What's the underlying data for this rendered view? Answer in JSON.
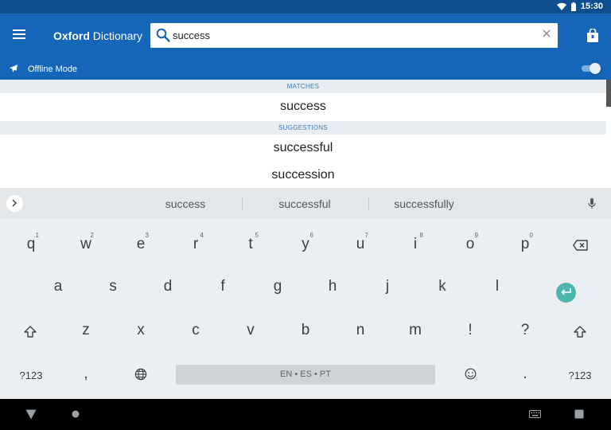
{
  "status_bar": {
    "time": "15:30"
  },
  "app_bar": {
    "title_bold": "Oxford",
    "title_rest": " Dictionary",
    "search": {
      "value": "success",
      "placeholder": ""
    }
  },
  "offline": {
    "label": "Offline Mode",
    "enabled": true
  },
  "results": {
    "matches_header": "MATCHES",
    "matches": [
      "success"
    ],
    "suggestions_header": "SUGGESTIONS",
    "suggestions": [
      "successful",
      "succession"
    ]
  },
  "keyboard": {
    "suggestions": [
      "success",
      "successful",
      "successfully"
    ],
    "row1": [
      {
        "ch": "q",
        "num": "1"
      },
      {
        "ch": "w",
        "num": "2"
      },
      {
        "ch": "e",
        "num": "3"
      },
      {
        "ch": "r",
        "num": "4"
      },
      {
        "ch": "t",
        "num": "5"
      },
      {
        "ch": "y",
        "num": "6"
      },
      {
        "ch": "u",
        "num": "7"
      },
      {
        "ch": "i",
        "num": "8"
      },
      {
        "ch": "o",
        "num": "9"
      },
      {
        "ch": "p",
        "num": "0"
      }
    ],
    "row2": [
      "a",
      "s",
      "d",
      "f",
      "g",
      "h",
      "j",
      "k",
      "l"
    ],
    "row3": [
      "z",
      "x",
      "c",
      "v",
      "b",
      "n",
      "m",
      "!",
      "?"
    ],
    "symbols_left": "?123",
    "comma": ",",
    "space_label": "EN • ES • PT",
    "period": ".",
    "symbols_right": "?123"
  },
  "icons": {
    "menu": "menu-icon",
    "search": "search-icon",
    "clear": "close-icon",
    "bag": "shopping-bag-icon",
    "plane": "airplane-icon",
    "mic": "microphone-icon",
    "backspace": "backspace-icon",
    "enter": "enter-icon",
    "shift": "shift-icon",
    "globe": "globe-icon",
    "emoji": "emoji-icon",
    "back": "back-triangle-icon",
    "home": "home-circle-icon",
    "keyboard": "keyboard-icon",
    "recents": "recents-square-icon"
  },
  "colors": {
    "status_bar": "#0d4f8f",
    "app_bar": "#1565b8",
    "section_header_text": "#3a7bbf",
    "enter_key": "#4db6ac",
    "keyboard_bg": "#eceff1"
  }
}
